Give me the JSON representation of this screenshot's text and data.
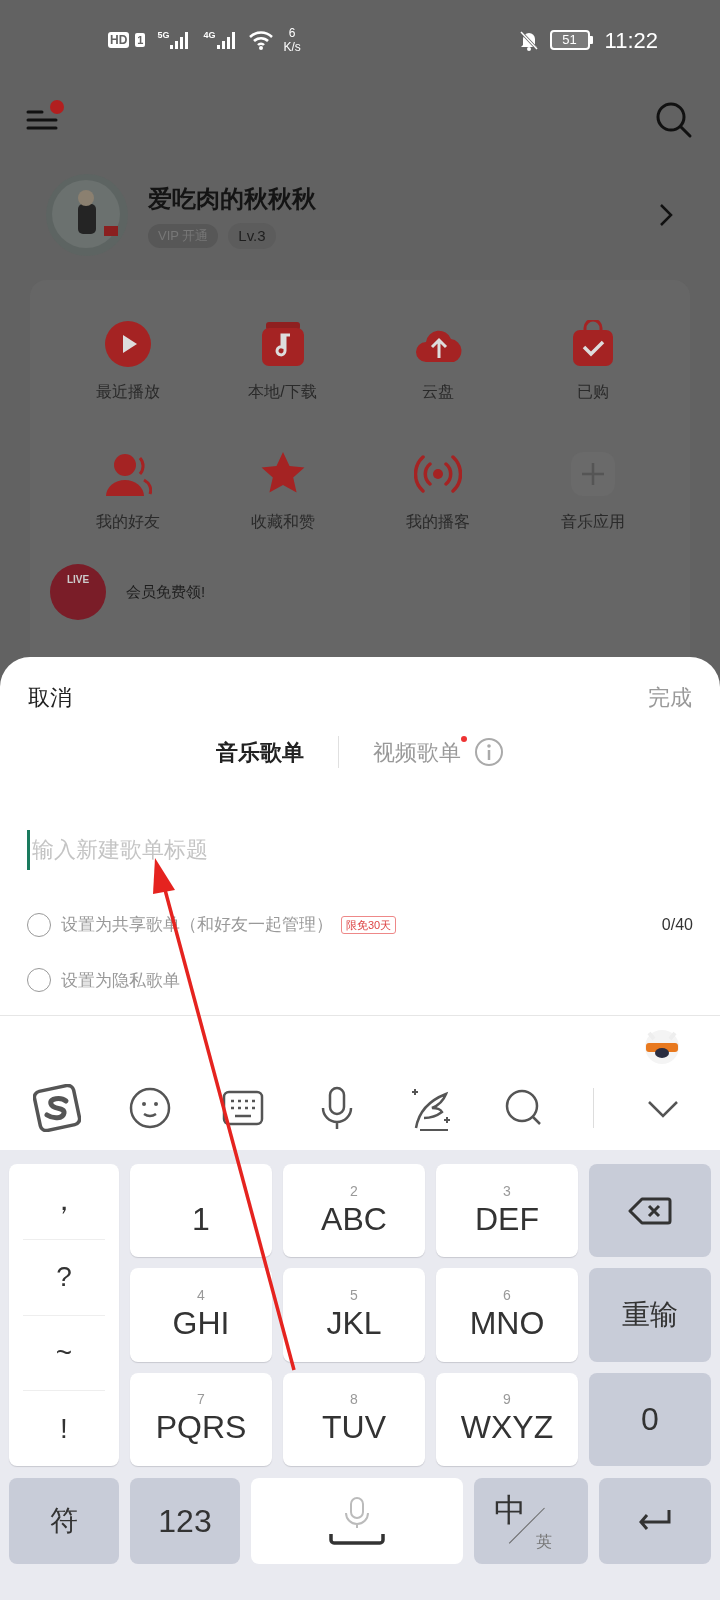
{
  "status_bar": {
    "hd": "HD",
    "sim": "1",
    "signal_1": "5G",
    "signal_2": "4G",
    "speed": "6",
    "speed_unit": "K/s",
    "battery": "51",
    "time": "11:22"
  },
  "header": {
    "menu_dot": true
  },
  "profile": {
    "name": "爱吃肉的秋秋秋",
    "vip": "VIP 开通",
    "level": "Lv.3"
  },
  "shortcuts": [
    {
      "label": "最近播放",
      "kind": "play"
    },
    {
      "label": "本地/下载",
      "kind": "music"
    },
    {
      "label": "云盘",
      "kind": "cloud"
    },
    {
      "label": "已购",
      "kind": "bag"
    },
    {
      "label": "我的好友",
      "kind": "friends"
    },
    {
      "label": "收藏和赞",
      "kind": "star"
    },
    {
      "label": "我的播客",
      "kind": "broadcast"
    },
    {
      "label": "音乐应用",
      "kind": "add"
    }
  ],
  "promo": {
    "badge": "LIVE",
    "text": "会员免费领!"
  },
  "sheet": {
    "cancel": "取消",
    "done": "完成",
    "tabs": [
      {
        "label": "音乐歌单",
        "selected": true,
        "dot": false
      },
      {
        "label": "视频歌单",
        "selected": false,
        "dot": true
      }
    ],
    "title_field": {
      "placeholder": "输入新建歌单标题",
      "counter": "0/40"
    },
    "options": [
      {
        "label": "设置为共享歌单（和好友一起管理）",
        "tag": "限免30天",
        "checked": false
      },
      {
        "label": "设置为隐私歌单",
        "checked": false
      }
    ]
  },
  "keyboard": {
    "symbols": [
      "，",
      "?",
      "~",
      "!"
    ],
    "key_rows": [
      {
        "keys": [
          {
            "letters": "1"
          },
          {
            "letters": "ABC",
            "digit": "2"
          },
          {
            "letters": "DEF",
            "digit": "3"
          }
        ]
      },
      {
        "keys": [
          {
            "letters": "GHI",
            "digit": "4"
          },
          {
            "letters": "JKL",
            "digit": "5"
          },
          {
            "letters": "MNO",
            "digit": "6"
          }
        ]
      },
      {
        "keys": [
          {
            "letters": "PQRS",
            "digit": "7"
          },
          {
            "letters": "TUV",
            "digit": "8"
          },
          {
            "letters": "WXYZ",
            "digit": "9"
          }
        ]
      }
    ],
    "reset": "重输",
    "zero": "0",
    "symbol_key": "符",
    "number_key": "123",
    "lang_main": "中",
    "lang_alt": "英"
  }
}
